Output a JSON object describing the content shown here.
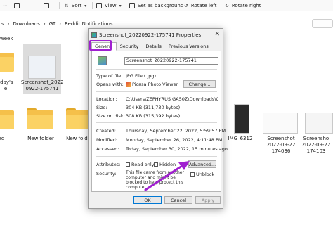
{
  "toolbar": {
    "sort_label": "Sort",
    "view_label": "View",
    "set_background_label": "Set as background",
    "rotate_left_label": "Rotate left",
    "rotate_right_label": "Rotate right"
  },
  "breadcrumb": [
    "s",
    "Downloads",
    "GT",
    "Reddit Notifications"
  ],
  "left_group_label": "week",
  "tiles": {
    "partial_1": "rday's",
    "partial_1b": "e",
    "selected_line1": "Screenshot_2022",
    "selected_line2": "0922-175741",
    "new_folder_1": "New folder",
    "new_folder_2": "New folder",
    "left_edge_1": "ed",
    "img": "IMG_6312",
    "shot1_line1": "Screenshot",
    "shot1_line2": "2022-09-22",
    "shot1_line3": "174036",
    "shot2_line1": "Screensho",
    "shot2_line2": "2022-09-22",
    "shot2_line3": "174103"
  },
  "dialog": {
    "title": "Screenshot_20220922-175741 Properties",
    "tabs": [
      "General",
      "Security",
      "Details",
      "Previous Versions"
    ],
    "file_name": "Screenshot_20220922-175741",
    "type_label": "Type of file:",
    "type_value": "JPG File (.jpg)",
    "opens_label": "Opens with:",
    "opens_value": "Picasa Photo Viewer",
    "change_button": "Change...",
    "location_label": "Location:",
    "location_value": "C:\\Users\\ZEPHYRUS GA50Z\\Downloads\\GT\\Reddit N",
    "size_label": "Size:",
    "size_value": "304 KB (311,730 bytes)",
    "size_disk_label": "Size on disk:",
    "size_disk_value": "308 KB (315,392 bytes)",
    "created_label": "Created:",
    "created_value": "Thursday, September 22, 2022, 5:59:57 PM",
    "modified_label": "Modified:",
    "modified_value": "Monday, September 26, 2022, 4:11:48 PM",
    "accessed_label": "Accessed:",
    "accessed_value": "Today, September 30, 2022, 15 minutes ago",
    "attributes_label": "Attributes:",
    "readonly_label": "Read-only",
    "hidden_label": "Hidden",
    "advanced_button": "Advanced...",
    "security_label": "Security:",
    "security_text": "This file came from another computer and might be blocked to help protect this computer.",
    "unblock_label": "Unblock",
    "ok_button": "OK",
    "cancel_button": "Cancel",
    "apply_button": "Apply"
  },
  "colors": {
    "highlight": "#a020d0",
    "folder": "#f5c04a",
    "accent": "#0078d4"
  }
}
